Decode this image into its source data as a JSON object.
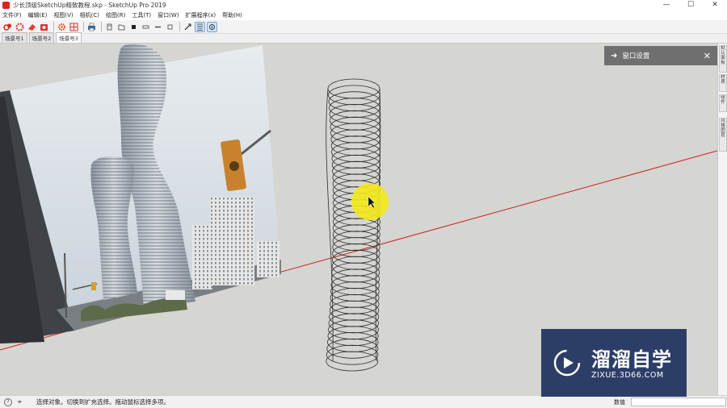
{
  "window": {
    "title": "少长顶级SketchUp精致教程.skp - SketchUp Pro 2019",
    "minimize": "—",
    "maximize": "☐",
    "close": "✕"
  },
  "menu": [
    "文件(F)",
    "编辑(E)",
    "视图(V)",
    "相机(C)",
    "绘图(R)",
    "工具(T)",
    "窗口(W)",
    "扩展程序(x)",
    "帮助(H)"
  ],
  "toolbar": {
    "icons": [
      "select-icon",
      "paint-icon",
      "eraser-icon",
      "camera-icon",
      "gear-icon",
      "grid-icon",
      "print-icon",
      "iso-view-icon",
      "top-view-icon",
      "front-view-icon",
      "right-view-icon",
      "back-view-icon",
      "left-view-icon",
      "axes-icon",
      "xray-icon",
      "shadow-icon"
    ]
  },
  "scenes": {
    "tabs": [
      "场景号1",
      "场景号2",
      "场景号3"
    ],
    "active_index": 2
  },
  "tray": {
    "title": "窗口设置",
    "arrow": "➜",
    "close": "✕"
  },
  "right_panel": {
    "tabs": [
      "默认面板",
      "材质",
      "组件",
      "风格图层"
    ]
  },
  "status": {
    "message": "选择对象。切换到扩充选择。拖动鼠标选择多项。",
    "measure_label": "数值",
    "measure_value": ""
  },
  "watermark": {
    "title": "溜溜自学",
    "subtitle": "ZIXUE.3D66.COM"
  },
  "colors": {
    "viewport_bg": "#d5d5d1",
    "axis_red": "#cc2222",
    "cursor_highlight": "#f2e81e",
    "watermark_bg": "#2c3e68"
  }
}
